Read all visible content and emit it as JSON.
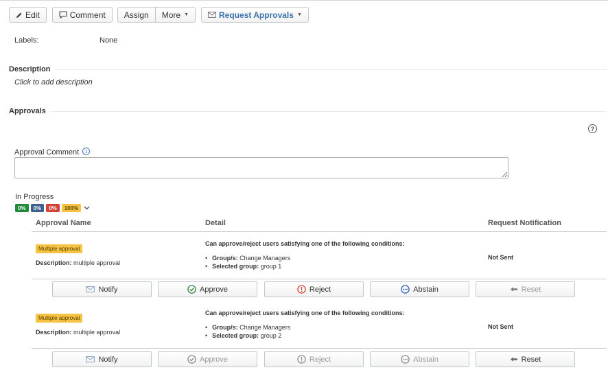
{
  "toolbar": {
    "edit_label": "Edit",
    "comment_label": "Comment",
    "assign_label": "Assign",
    "more_label": "More",
    "request_approvals_label": "Request Approvals"
  },
  "fields": {
    "labels_key": "Labels:",
    "labels_value": "None"
  },
  "description": {
    "heading": "Description",
    "placeholder": "Click to add description"
  },
  "approvals": {
    "heading": "Approvals",
    "help_glyph": "?",
    "comment_label": "Approval Comment",
    "info_glyph": "i",
    "comment_value": "",
    "status": "In Progress",
    "badges": [
      "0%",
      "0%",
      "0%",
      "100%"
    ],
    "columns": {
      "name": "Approval Name",
      "detail": "Detail",
      "notification": "Request Notification"
    },
    "rows": [
      {
        "badge": "Multiple approval",
        "desc_key": "Description:",
        "desc_value": "multiple approval",
        "condition_heading": "Can approve/reject users satisfying one of the following conditions:",
        "cond1_key": "Group/s:",
        "cond1_value": "Change Managers",
        "cond2_key": "Selected group:",
        "cond2_value": "group 1",
        "notification": "Not Sent"
      },
      {
        "badge": "Multiple approval",
        "desc_key": "Description:",
        "desc_value": "multiple approval",
        "condition_heading": "Can approve/reject users satisfying one of the following conditions:",
        "cond1_key": "Group/s:",
        "cond1_value": "Change Managers",
        "cond2_key": "Selected group:",
        "cond2_value": "group 2",
        "notification": "Not Sent"
      }
    ],
    "actions": {
      "notify": "Notify",
      "approve": "Approve",
      "reject": "Reject",
      "abstain": "Abstain",
      "reset": "Reset"
    }
  },
  "colors": {
    "approve": "#2e8540",
    "reject": "#d04437",
    "abstain": "#2a5ab8",
    "badge_yellow": "#f6c342",
    "link_blue": "#3b73af"
  },
  "icons": [
    "pencil-icon",
    "comment-icon",
    "envelope-icon",
    "check-circle-icon",
    "exclamation-circle-icon",
    "ellipsis-circle-icon",
    "undo-arrow-icon",
    "help-icon",
    "info-icon",
    "chevron-down-icon"
  ]
}
